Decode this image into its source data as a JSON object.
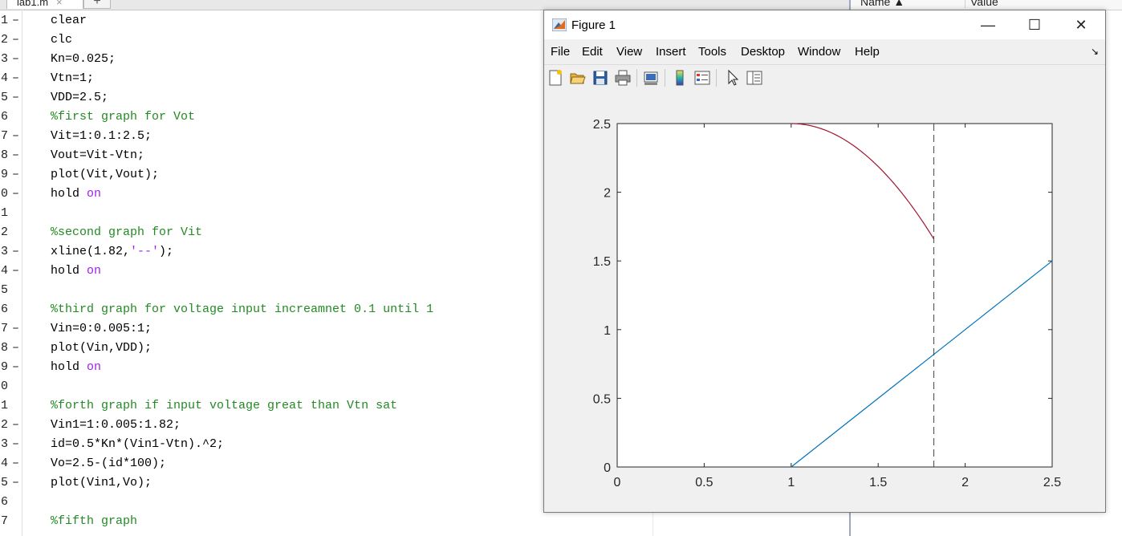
{
  "editor": {
    "tab_label": "lab1.m",
    "tab_close": "×",
    "new_tab": "+",
    "lines": [
      {
        "n": "1",
        "dash": "–",
        "segments": [
          {
            "t": "clear",
            "c": "default"
          }
        ]
      },
      {
        "n": "2",
        "dash": "–",
        "segments": [
          {
            "t": "clc",
            "c": "default"
          }
        ]
      },
      {
        "n": "3",
        "dash": "–",
        "segments": [
          {
            "t": "Kn=0.025;",
            "c": "default"
          }
        ]
      },
      {
        "n": "4",
        "dash": "–",
        "segments": [
          {
            "t": "Vtn=1;",
            "c": "default"
          }
        ]
      },
      {
        "n": "5",
        "dash": "–",
        "segments": [
          {
            "t": "VDD=2.5;",
            "c": "default"
          }
        ]
      },
      {
        "n": "6",
        "dash": "",
        "segments": [
          {
            "t": "%first graph for Vot",
            "c": "comment"
          }
        ]
      },
      {
        "n": "7",
        "dash": "–",
        "segments": [
          {
            "t": "Vit=1:0.1:2.5;",
            "c": "default"
          }
        ]
      },
      {
        "n": "8",
        "dash": "–",
        "segments": [
          {
            "t": "Vout=Vit-Vtn;",
            "c": "default"
          }
        ]
      },
      {
        "n": "9",
        "dash": "–",
        "segments": [
          {
            "t": "plot(Vit,Vout);",
            "c": "default"
          }
        ]
      },
      {
        "n": "0",
        "dash": "–",
        "segments": [
          {
            "t": "hold ",
            "c": "default"
          },
          {
            "t": "on",
            "c": "keyword"
          }
        ]
      },
      {
        "n": "1",
        "dash": "",
        "segments": []
      },
      {
        "n": "2",
        "dash": "",
        "segments": [
          {
            "t": "%second graph for Vit",
            "c": "comment"
          }
        ]
      },
      {
        "n": "3",
        "dash": "–",
        "segments": [
          {
            "t": "xline(1.82,",
            "c": "default"
          },
          {
            "t": "'--'",
            "c": "string"
          },
          {
            "t": ");",
            "c": "default"
          }
        ]
      },
      {
        "n": "4",
        "dash": "–",
        "segments": [
          {
            "t": "hold ",
            "c": "default"
          },
          {
            "t": "on",
            "c": "keyword"
          }
        ]
      },
      {
        "n": "5",
        "dash": "",
        "segments": []
      },
      {
        "n": "6",
        "dash": "",
        "segments": [
          {
            "t": "%third graph for voltage input increamnet 0.1 until 1",
            "c": "comment"
          }
        ]
      },
      {
        "n": "7",
        "dash": "–",
        "segments": [
          {
            "t": "Vin=0:0.005:1;",
            "c": "default"
          }
        ]
      },
      {
        "n": "8",
        "dash": "–",
        "segments": [
          {
            "t": "plot(Vin,VDD);",
            "c": "default"
          }
        ]
      },
      {
        "n": "9",
        "dash": "–",
        "segments": [
          {
            "t": "hold ",
            "c": "default"
          },
          {
            "t": "on",
            "c": "keyword"
          }
        ]
      },
      {
        "n": "0",
        "dash": "",
        "segments": []
      },
      {
        "n": "1",
        "dash": "",
        "segments": [
          {
            "t": "%forth graph if input voltage great than Vtn sat",
            "c": "comment"
          }
        ]
      },
      {
        "n": "2",
        "dash": "–",
        "segments": [
          {
            "t": "Vin1=1:0.005:1.82;",
            "c": "default"
          }
        ]
      },
      {
        "n": "3",
        "dash": "–",
        "segments": [
          {
            "t": "id=0.5*Kn*(Vin1-Vtn).^2;",
            "c": "default"
          }
        ]
      },
      {
        "n": "4",
        "dash": "–",
        "segments": [
          {
            "t": "Vo=2.5-(id*100);",
            "c": "default"
          }
        ]
      },
      {
        "n": "5",
        "dash": "–",
        "segments": [
          {
            "t": "plot(Vin1,Vo);",
            "c": "default"
          }
        ]
      },
      {
        "n": "6",
        "dash": "",
        "segments": []
      },
      {
        "n": "7",
        "dash": "",
        "segments": [
          {
            "t": "%fifth graph",
            "c": "comment"
          }
        ]
      }
    ]
  },
  "workspace": {
    "col_name": "Name ▲",
    "col_value": "Value"
  },
  "figure": {
    "title": "Figure 1",
    "minimize": "—",
    "maximize": "☐",
    "close": "✕",
    "menus": [
      "File",
      "Edit",
      "View",
      "Insert",
      "Tools",
      "Desktop",
      "Window",
      "Help"
    ],
    "toolbar_icons": [
      "new-figure-icon",
      "open-file-icon",
      "save-icon",
      "print-icon",
      "link-plot-icon",
      "colorbar-icon",
      "legend-icon",
      "edit-plot-pointer-icon",
      "property-inspector-icon"
    ]
  },
  "colors": {
    "series_blue": "#0072bd",
    "series_red": "#a2142f",
    "comment_green": "#228b22",
    "keyword_purple": "#a020f0"
  },
  "chart_data": {
    "type": "line",
    "xlim": [
      0,
      2.5
    ],
    "ylim": [
      0,
      2.5
    ],
    "x_ticks": [
      0,
      0.5,
      1,
      1.5,
      2,
      2.5
    ],
    "x_tick_labels": [
      "0",
      "0.5",
      "1",
      "1.5",
      "2",
      "2.5"
    ],
    "y_ticks": [
      0,
      0.5,
      1,
      1.5,
      2,
      2.5
    ],
    "y_tick_labels": [
      "0",
      "0.5",
      "1",
      "1.5",
      "2",
      "2.5"
    ],
    "grid": false,
    "series": [
      {
        "style": "line",
        "color": "#0072bd",
        "x": [
          1,
          1.1,
          1.2,
          1.3,
          1.4,
          1.5,
          1.6,
          1.7,
          1.8,
          1.9,
          2.0,
          2.1,
          2.2,
          2.3,
          2.4,
          2.5
        ],
        "y": [
          0,
          0.1,
          0.2,
          0.3,
          0.4,
          0.5,
          0.6,
          0.7,
          0.8,
          0.9,
          1.0,
          1.1,
          1.2,
          1.3,
          1.4,
          1.5
        ]
      },
      {
        "style": "line",
        "color": "#a2142f",
        "x": [
          1,
          1.1,
          1.2,
          1.3,
          1.4,
          1.5,
          1.6,
          1.7,
          1.8,
          1.82
        ],
        "y": [
          2.5,
          2.4875,
          2.45,
          2.3875,
          2.3,
          2.1875,
          2.05,
          1.8875,
          1.7,
          1.6595
        ]
      },
      {
        "style": "vline",
        "color": "#444444",
        "x": [
          1.82
        ],
        "dash": "dashed"
      }
    ]
  }
}
